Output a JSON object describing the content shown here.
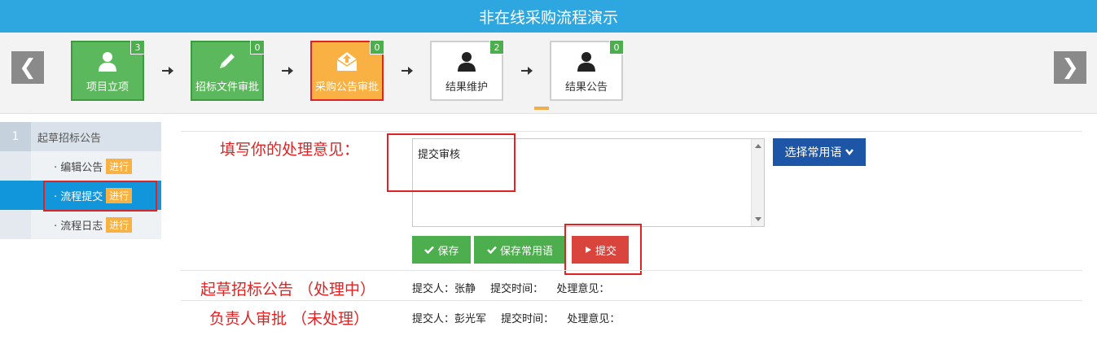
{
  "header": {
    "title": "非在线采购流程演示"
  },
  "nav": {
    "prev_label": "❮",
    "next_label": "❯"
  },
  "steps": [
    {
      "label": "项目立项",
      "count": "3"
    },
    {
      "label": "招标文件审批",
      "count": "0"
    },
    {
      "label": "采购公告审批",
      "count": "0"
    },
    {
      "label": "结果维护",
      "count": "2"
    },
    {
      "label": "结果公告",
      "count": "0"
    }
  ],
  "sidebar": {
    "group_num": "1",
    "group_label": "起草招标公告",
    "items": [
      {
        "label": "· 编辑公告",
        "tag": "进行"
      },
      {
        "label": "· 流程提交",
        "tag": "进行"
      },
      {
        "label": "· 流程日志",
        "tag": "进行"
      }
    ]
  },
  "form": {
    "opinion_label": "填写你的处理意见：",
    "opinion_value": "提交审核",
    "phrases_button": "选择常用语",
    "save_button": "保存",
    "save_phrase_button": "保存常用语",
    "submit_button": "提交"
  },
  "log": [
    {
      "title": "起草招标公告 （处理中）",
      "submitter_label": "提交人：",
      "submitter": "张静",
      "time_label": "提交时间：",
      "opinion_label": "处理意见："
    },
    {
      "title": "负责人审批 （未处理）",
      "submitter_label": "提交人：",
      "submitter": "彭光军",
      "time_label": "提交时间：",
      "opinion_label": "处理意见："
    }
  ],
  "colors": {
    "header": "#2ea7e0",
    "done": "#5cb85c",
    "current": "#f8b142",
    "active_side": "#1296db",
    "annotation": "#e02222",
    "primary": "#1e56a7"
  }
}
